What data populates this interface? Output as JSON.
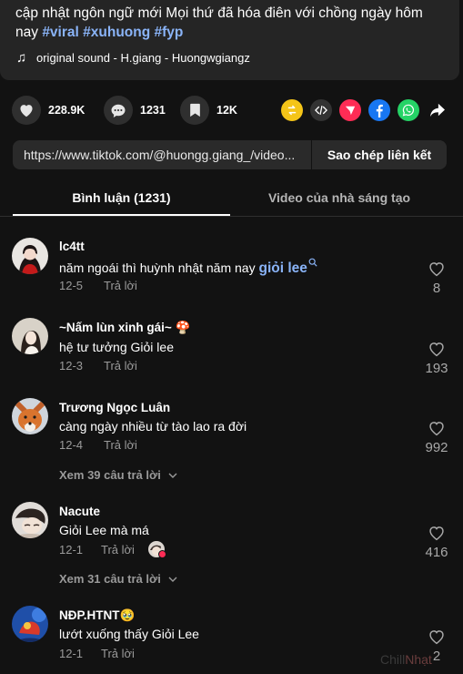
{
  "description": {
    "text_line1": "cập nhật ngôn ngữ mới Mọi thứ đã hóa điên với chồng ngày hôm",
    "text_line2_prefix": "nay ",
    "hashtags": [
      "#viral",
      "#xuhuong",
      "#fyp"
    ],
    "music_icon": "music-note-icon",
    "music": "original sound - H.giang - Huongwgiangz"
  },
  "stats": {
    "likes": "228.9K",
    "comments": "1231",
    "saves": "12K"
  },
  "share": {
    "icons": [
      "repost-icon",
      "embed-icon",
      "send-icon",
      "facebook-icon",
      "whatsapp-icon",
      "share-arrow-icon"
    ],
    "colors": {
      "repost": "#f5c518",
      "send": "#fe2c55",
      "facebook": "#1877f2",
      "whatsapp": "#25d366"
    }
  },
  "link": {
    "url": "https://www.tiktok.com/@huongg.giang_/video...",
    "copy_label": "Sao chép liên kết"
  },
  "tabs": {
    "comments": "Bình luận (1231)",
    "creator_videos": "Video của nhà sáng tạo"
  },
  "comments": [
    {
      "name": "lc4tt",
      "text_prefix": "năm ngoái thì huỳnh nhật năm nay ",
      "text_highlight": "giỏi lee",
      "date": "12-5",
      "reply": "Trả lời",
      "likes": "8"
    },
    {
      "name": "~Nấm lùn xinh gái~ 🍄",
      "text": "hệ tư tưởng Giỏi lee",
      "date": "12-3",
      "reply": "Trả lời",
      "likes": "193"
    },
    {
      "name": "Trương Ngọc Luân",
      "text": "càng ngày nhiều từ tào lao ra đời",
      "date": "12-4",
      "reply": "Trả lời",
      "likes": "992",
      "view_replies": "Xem 39 câu trả lời"
    },
    {
      "name": "Nacute",
      "text": "Giỏi Lee mà má",
      "date": "12-1",
      "reply": "Trả lời",
      "likes": "416",
      "view_replies": "Xem 31 câu trả lời"
    },
    {
      "name": "NĐP.HTNT🥹",
      "text": "lướt xuống thấy Giỏi Lee",
      "date": "12-1",
      "reply": "Trả lời",
      "likes": "2"
    }
  ],
  "watermark": {
    "part1": "Chill",
    "part2": "Nhạt"
  }
}
